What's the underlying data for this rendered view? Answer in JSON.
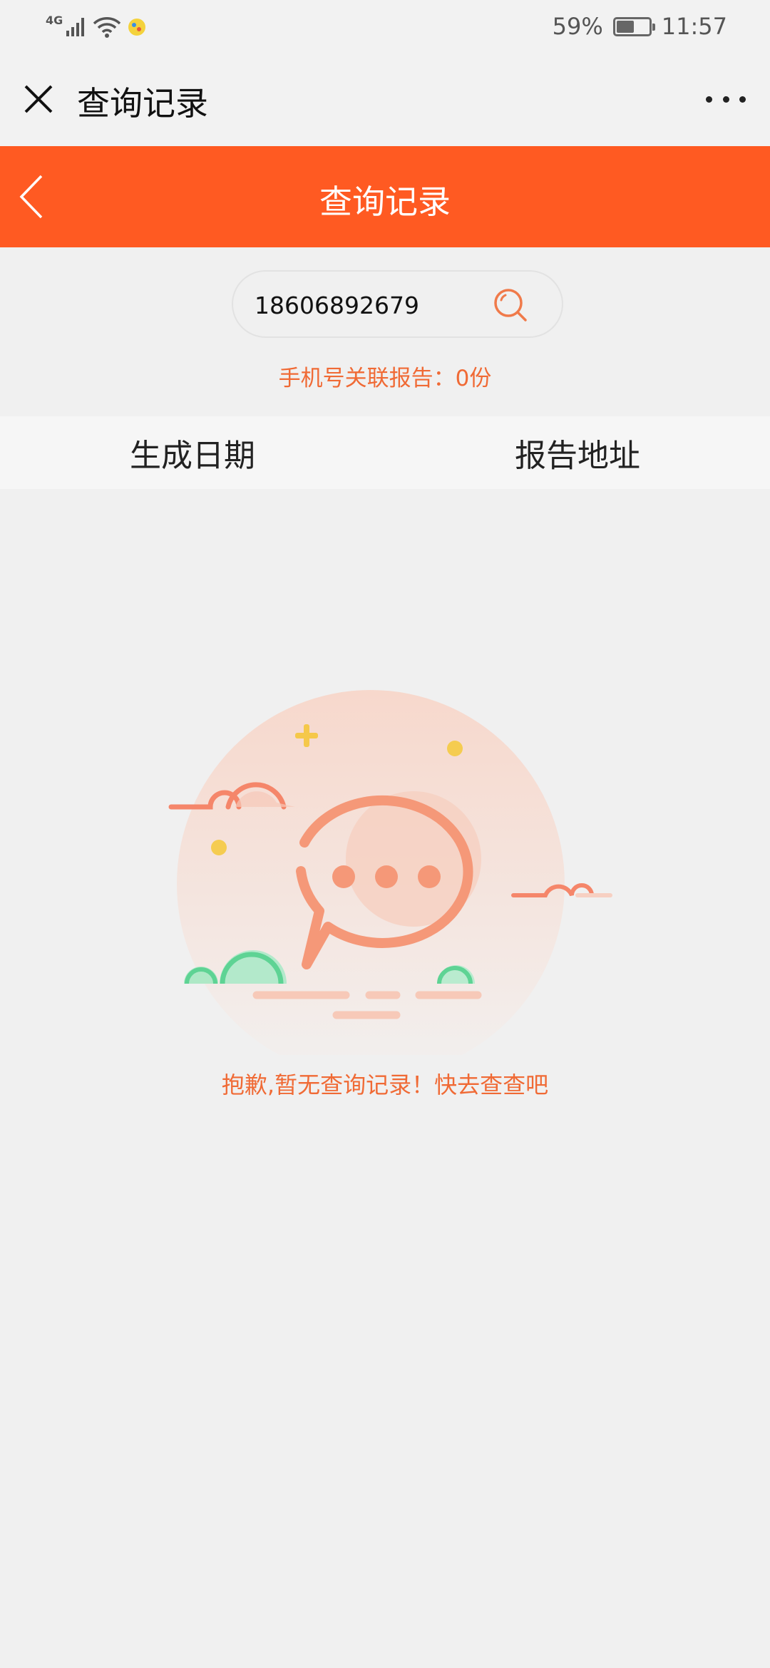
{
  "status_bar": {
    "network": "4G",
    "battery_percent": "59%",
    "battery_level": 0.59,
    "time": "11:57"
  },
  "top_bar": {
    "title": "查询记录"
  },
  "header": {
    "title": "查询记录",
    "accent_color": "#ff5a22"
  },
  "search": {
    "value": "18606892679",
    "placeholder": ""
  },
  "association": {
    "text": "手机号关联报告：0份"
  },
  "table": {
    "columns": [
      "生成日期",
      "报告地址"
    ]
  },
  "empty_state": {
    "message": "抱歉,暂无查询记录！快去查查吧",
    "illustration": "chat-bubble-illustration"
  },
  "icons": {
    "close": "close-icon",
    "more": "more-icon",
    "back": "back-chevron-icon",
    "search": "search-icon"
  }
}
